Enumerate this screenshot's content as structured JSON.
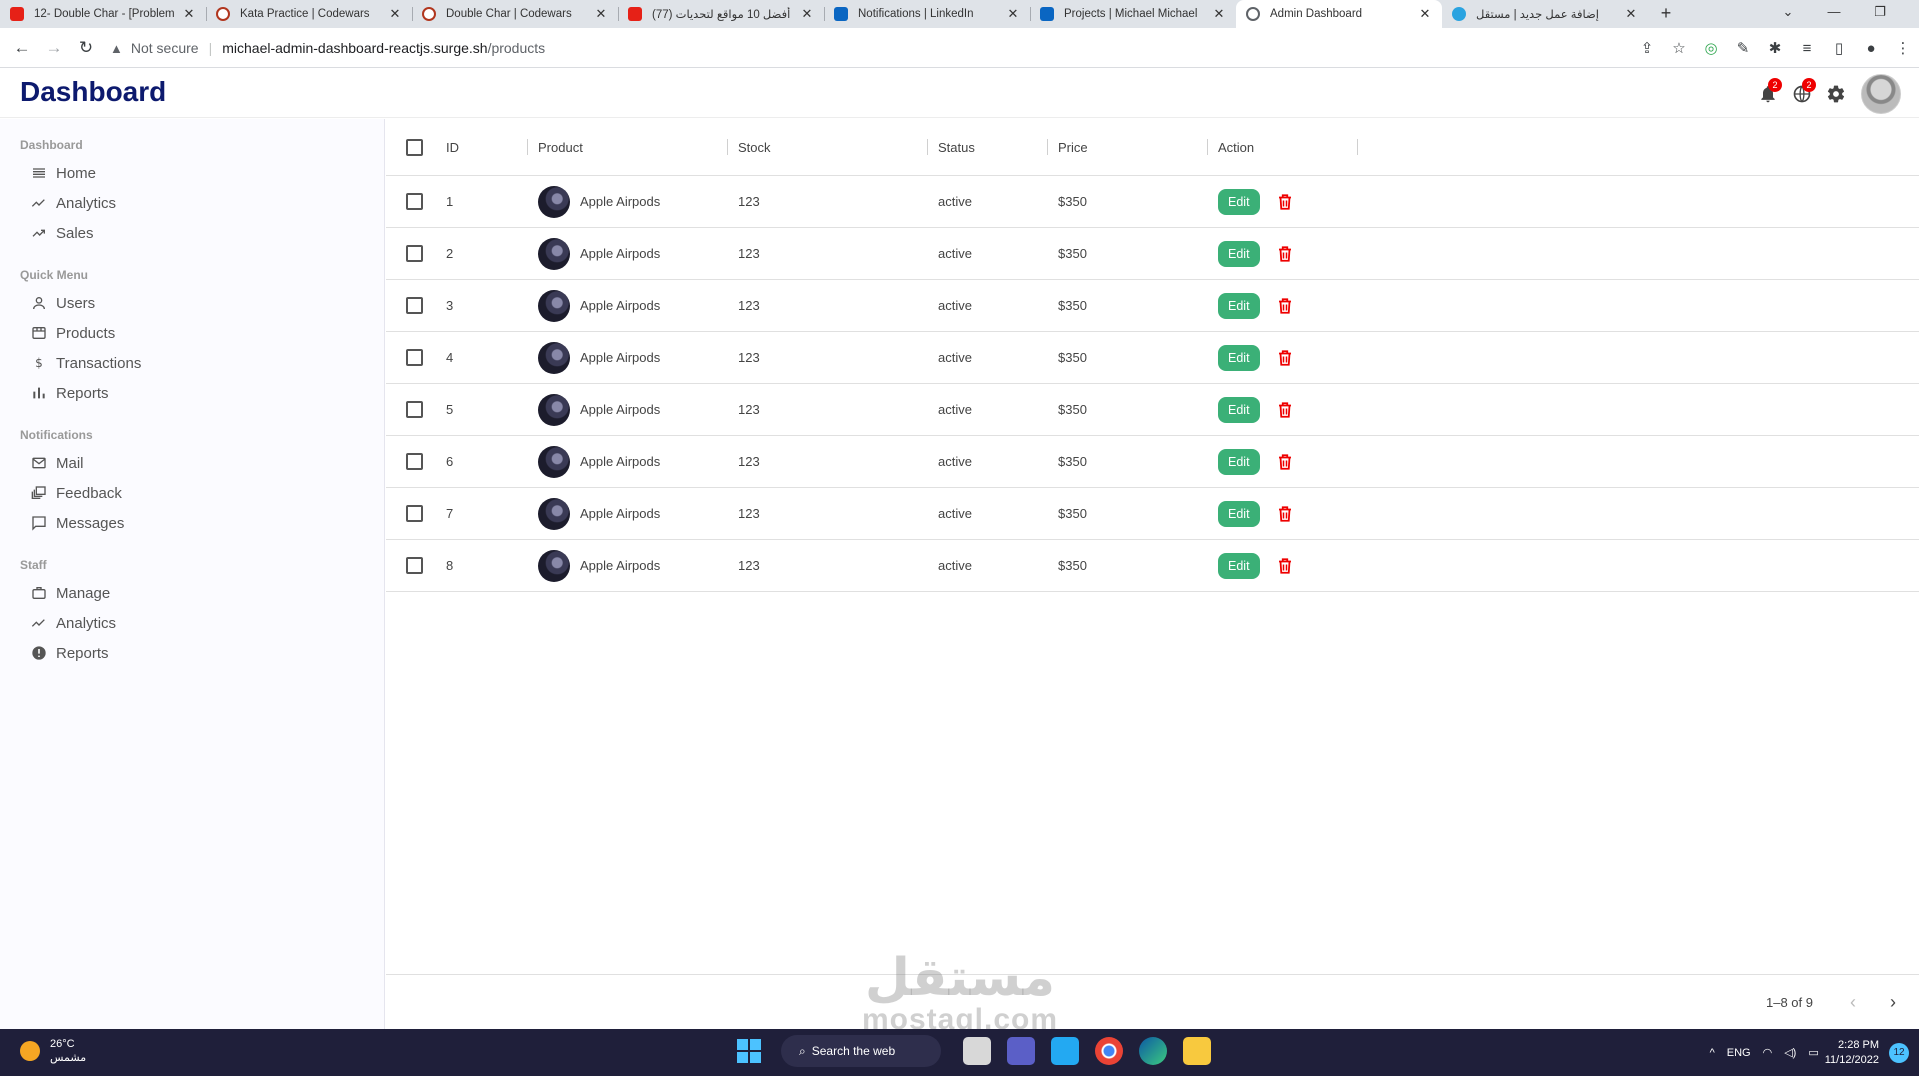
{
  "browser": {
    "tabs": [
      {
        "title": "12- Double Char - [Problem",
        "icon": "youtube-icon",
        "active": false
      },
      {
        "title": "Kata Practice | Codewars",
        "icon": "codewars-icon",
        "active": false
      },
      {
        "title": "Double Char | Codewars",
        "icon": "codewars-icon",
        "active": false
      },
      {
        "title": "(77) أفضل 10 مواقع لتحديات",
        "icon": "youtube-icon",
        "active": false
      },
      {
        "title": "Notifications | LinkedIn",
        "icon": "linkedin-icon",
        "active": false
      },
      {
        "title": "Projects | Michael Michael",
        "icon": "linkedin-icon",
        "active": false
      },
      {
        "title": "Admin Dashboard",
        "icon": "globe-icon",
        "active": true
      },
      {
        "title": "إضافة عمل جديد | مستقل",
        "icon": "mostaql-icon",
        "active": false
      }
    ],
    "security_label": "Not secure",
    "url_host": "michael-admin-dashboard-reactjs.surge.sh",
    "url_path": "/products"
  },
  "app": {
    "logo": "Dashboard",
    "notification_count": "2",
    "language_count": "2"
  },
  "sidebar": {
    "sections": [
      {
        "title": "Dashboard",
        "items": [
          {
            "label": "Home",
            "icon": "home-icon"
          },
          {
            "label": "Analytics",
            "icon": "timeline-icon"
          },
          {
            "label": "Sales",
            "icon": "trending-up-icon"
          }
        ]
      },
      {
        "title": "Quick Menu",
        "items": [
          {
            "label": "Users",
            "icon": "user-icon"
          },
          {
            "label": "Products",
            "icon": "storefront-icon"
          },
          {
            "label": "Transactions",
            "icon": "dollar-icon"
          },
          {
            "label": "Reports",
            "icon": "bar-chart-icon"
          }
        ]
      },
      {
        "title": "Notifications",
        "items": [
          {
            "label": "Mail",
            "icon": "mail-icon"
          },
          {
            "label": "Feedback",
            "icon": "dynamic-feed-icon"
          },
          {
            "label": "Messages",
            "icon": "chat-bubble-icon"
          }
        ]
      },
      {
        "title": "Staff",
        "items": [
          {
            "label": "Manage",
            "icon": "work-icon"
          },
          {
            "label": "Analytics",
            "icon": "timeline-icon"
          },
          {
            "label": "Reports",
            "icon": "report-icon"
          }
        ]
      }
    ]
  },
  "table": {
    "columns": [
      "ID",
      "Product",
      "Stock",
      "Status",
      "Price",
      "Action"
    ],
    "rows": [
      {
        "id": "1",
        "product": "Apple Airpods",
        "stock": "123",
        "status": "active",
        "price": "$350"
      },
      {
        "id": "2",
        "product": "Apple Airpods",
        "stock": "123",
        "status": "active",
        "price": "$350"
      },
      {
        "id": "3",
        "product": "Apple Airpods",
        "stock": "123",
        "status": "active",
        "price": "$350"
      },
      {
        "id": "4",
        "product": "Apple Airpods",
        "stock": "123",
        "status": "active",
        "price": "$350"
      },
      {
        "id": "5",
        "product": "Apple Airpods",
        "stock": "123",
        "status": "active",
        "price": "$350"
      },
      {
        "id": "6",
        "product": "Apple Airpods",
        "stock": "123",
        "status": "active",
        "price": "$350"
      },
      {
        "id": "7",
        "product": "Apple Airpods",
        "stock": "123",
        "status": "active",
        "price": "$350"
      },
      {
        "id": "8",
        "product": "Apple Airpods",
        "stock": "123",
        "status": "active",
        "price": "$350"
      }
    ],
    "edit_label": "Edit",
    "pagination": "1–8 of 9"
  },
  "watermark": {
    "arabic": "مستقل",
    "latin": "mostaql.com"
  },
  "taskbar": {
    "temperature": "26°C",
    "weather": "مشمس",
    "search_label": "Search the web",
    "language": "ENG",
    "time": "2:28 PM",
    "date": "11/12/2022",
    "notifications": "12"
  },
  "colors": {
    "logo": "#0d1a6e",
    "edit_button": "#3bb077",
    "delete_icon": "#e00000",
    "badge": "#e00000"
  }
}
